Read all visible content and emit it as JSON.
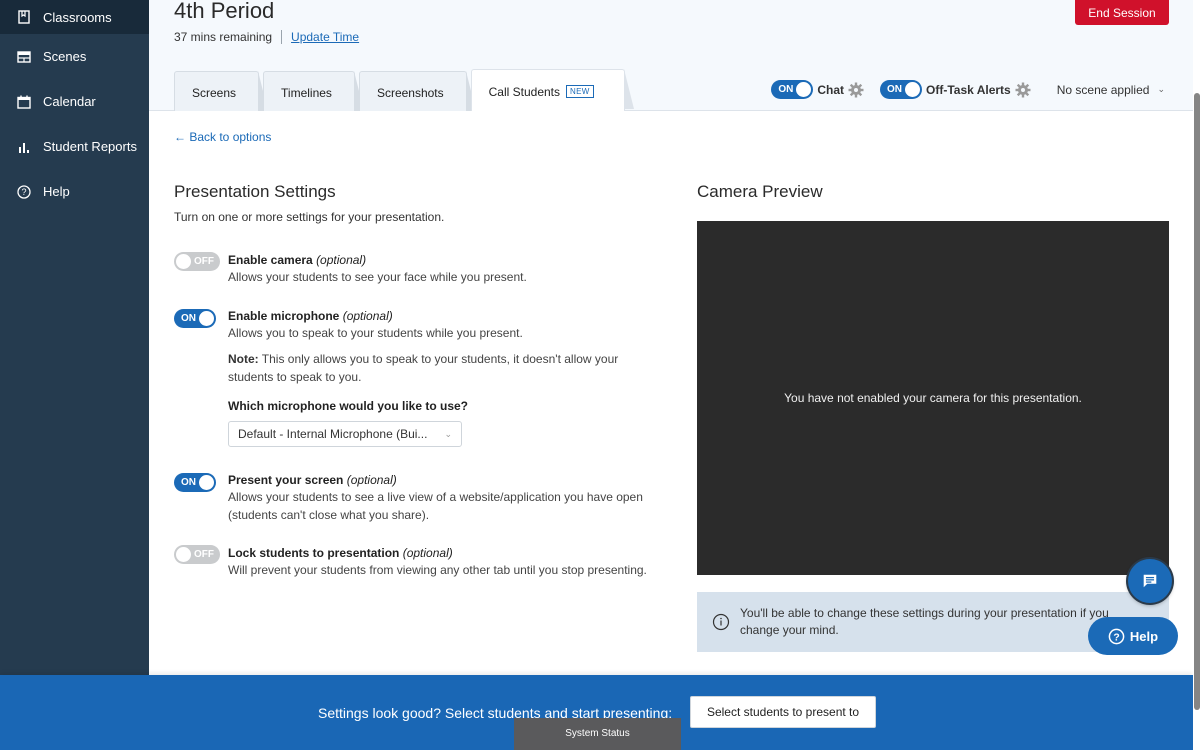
{
  "sidebar": {
    "items": [
      {
        "label": "Classrooms",
        "icon": "book-icon",
        "active": true
      },
      {
        "label": "Scenes",
        "icon": "scenes-icon"
      },
      {
        "label": "Calendar",
        "icon": "calendar-icon"
      },
      {
        "label": "Student Reports",
        "icon": "bar-chart-icon"
      },
      {
        "label": "Help",
        "icon": "help-circle-icon"
      }
    ]
  },
  "header": {
    "title": "4th Period",
    "time_remaining": "37 mins remaining",
    "update_time": "Update Time",
    "end_session": "End Session",
    "tabs": [
      {
        "label": "Screens"
      },
      {
        "label": "Timelines"
      },
      {
        "label": "Screenshots"
      },
      {
        "label": "Call Students",
        "badge": "NEW",
        "active": true
      }
    ],
    "chat": {
      "toggle": "ON",
      "label": "Chat"
    },
    "off_task": {
      "toggle": "ON",
      "label": "Off-Task Alerts"
    },
    "scene": "No scene applied"
  },
  "main": {
    "back_link": "← Back to options",
    "settings_title": "Presentation Settings",
    "settings_subtitle": "Turn on one or more settings for your presentation.",
    "optional": "(optional)",
    "settings": [
      {
        "title": "Enable camera",
        "state": "OFF",
        "desc": "Allows your students to see your face while you present."
      },
      {
        "title": "Enable microphone",
        "state": "ON",
        "desc": "Allows you to speak to your students while you present.",
        "note_label": "Note:",
        "note": " This only allows you to speak to your students, it doesn't allow your students to speak to you.",
        "question": "Which microphone would you like to use?",
        "mic_selected": "Default - Internal Microphone (Bui..."
      },
      {
        "title": "Present your screen",
        "state": "ON",
        "desc": "Allows your students to see a live view of a website/application you have open (students can't close what you share)."
      },
      {
        "title": "Lock students to presentation",
        "state": "OFF",
        "desc": "Will prevent your students from viewing any other tab until you stop presenting."
      }
    ],
    "camera_title": "Camera Preview",
    "camera_message": "You have not enabled your camera for this presentation.",
    "info_message": "You'll be able to change these settings during your presentation if you change your mind."
  },
  "floating": {
    "help_label": "Help"
  },
  "footer": {
    "prompt": "Settings look good? Select students and start presenting:",
    "button": "Select students to present to",
    "system_status": "System Status"
  },
  "colors": {
    "accent": "#1b6ab7",
    "danger": "#d0112b",
    "sidebar": "#253b4f",
    "footer": "#1a67b5"
  }
}
